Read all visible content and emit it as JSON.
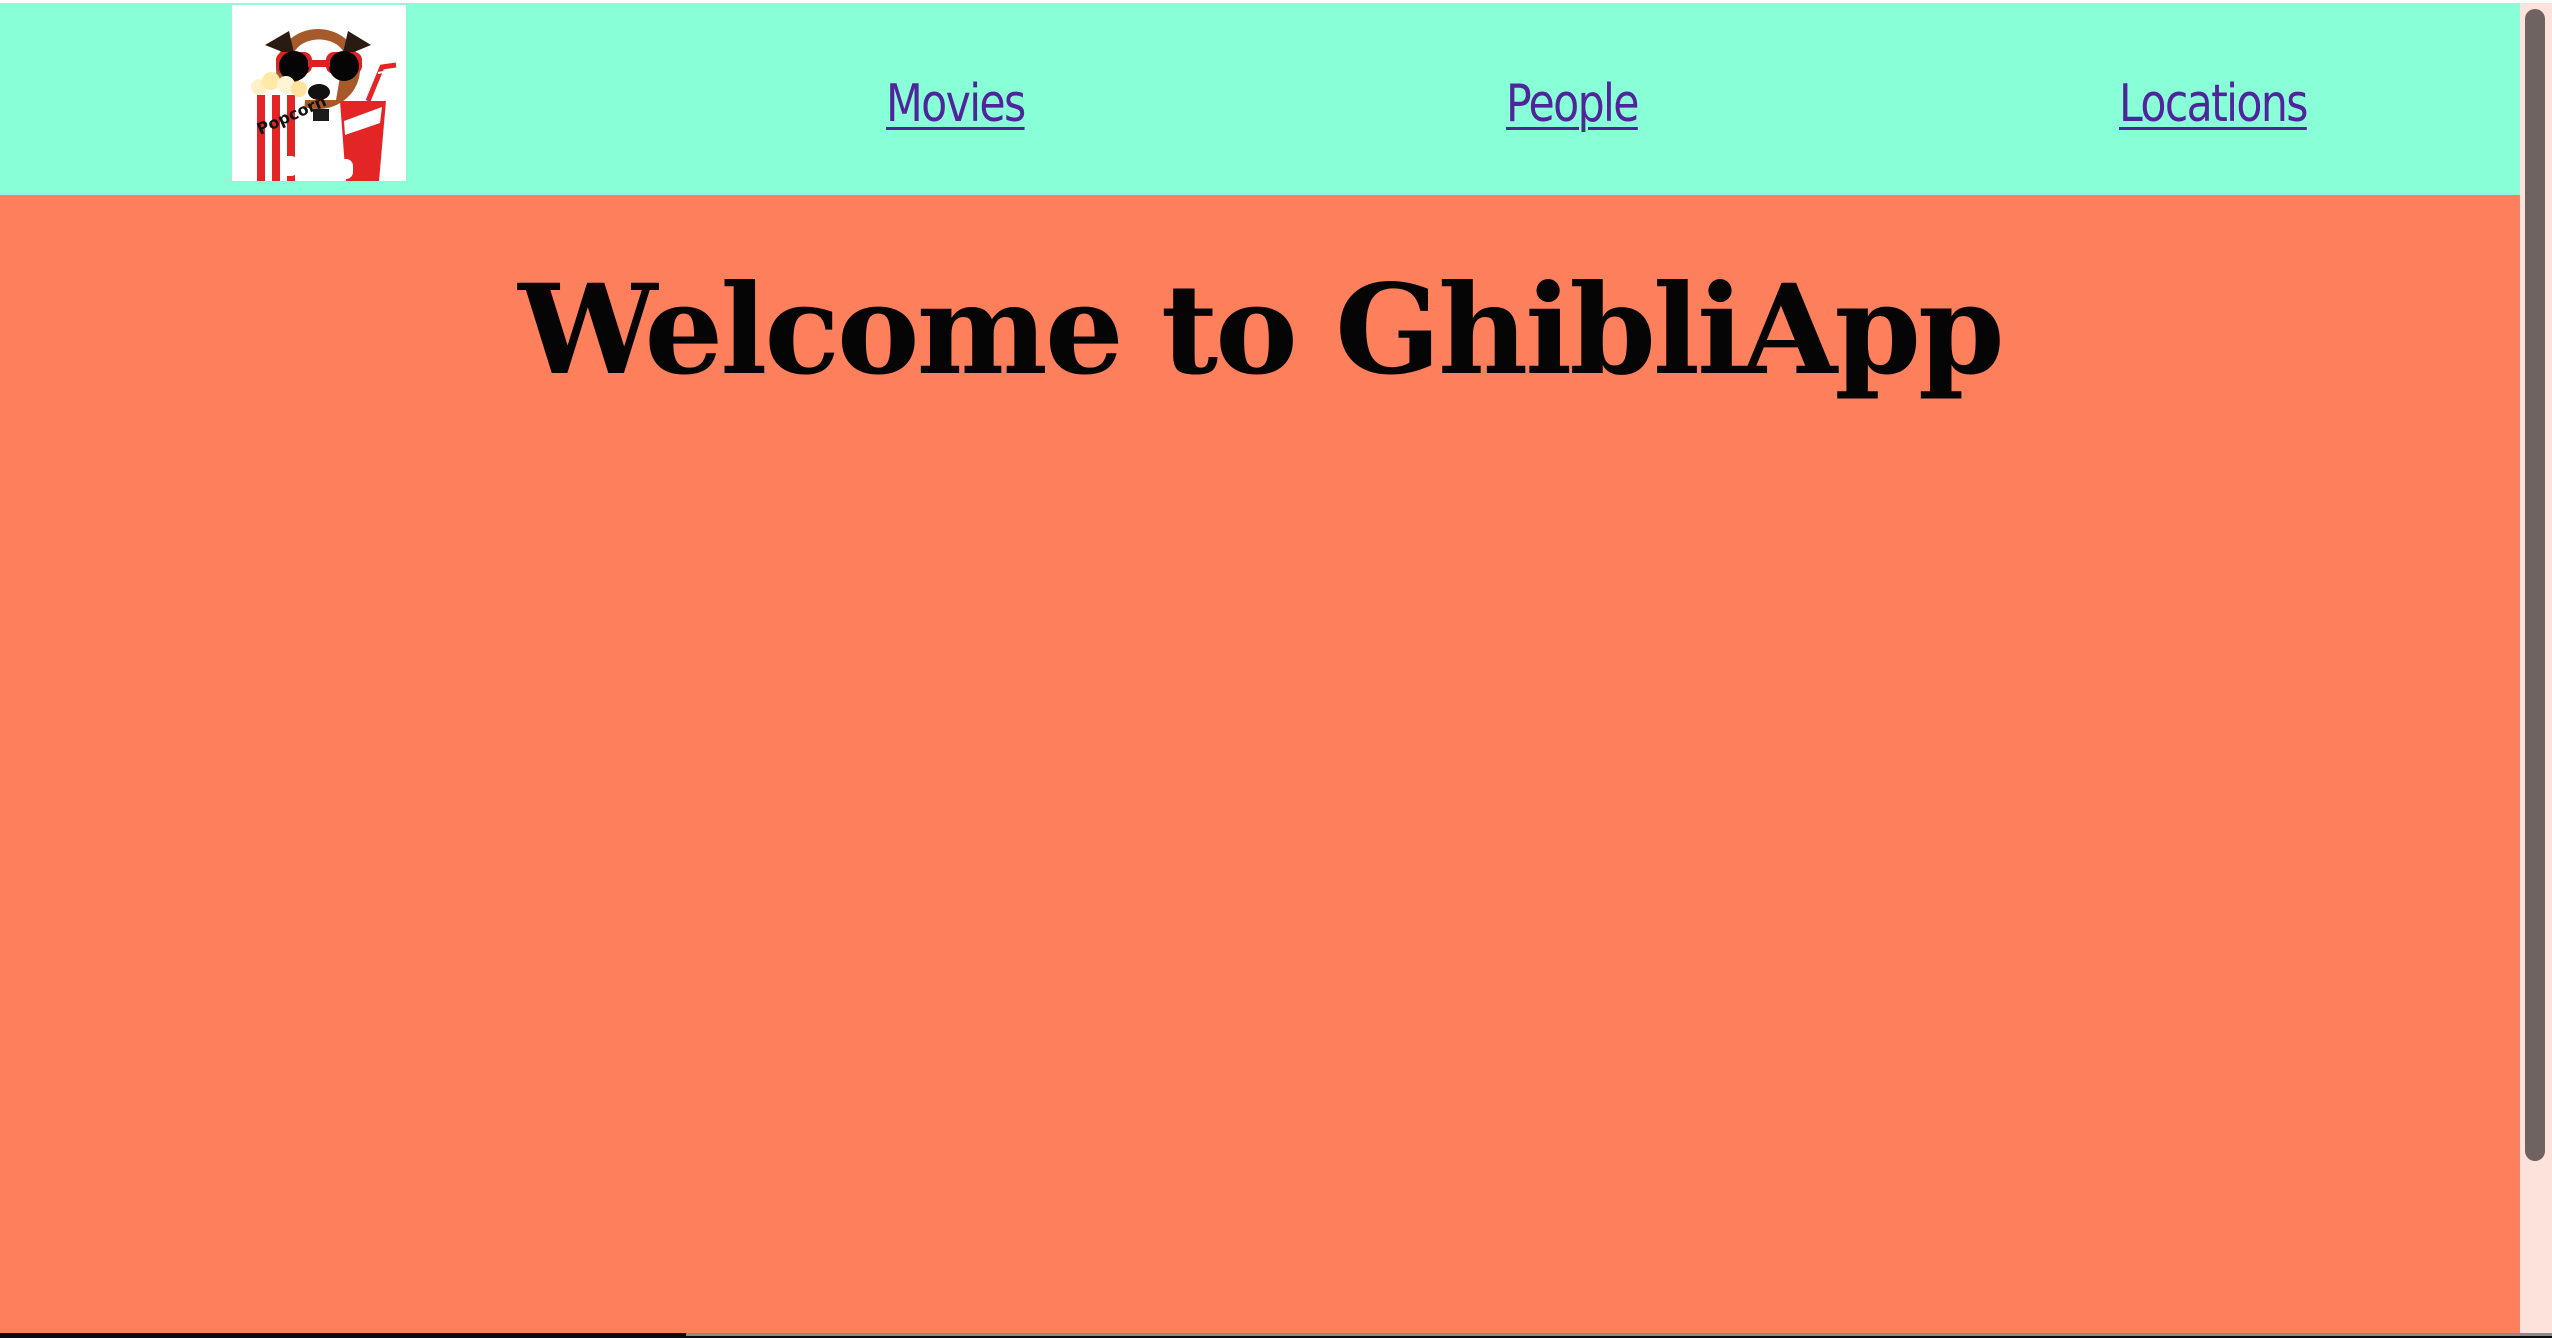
{
  "header": {
    "logo_icon": "popcorn-dog-icon",
    "logo_text": "Popcorn",
    "nav": [
      {
        "label": "Movies"
      },
      {
        "label": "People"
      },
      {
        "label": "Locations"
      }
    ]
  },
  "main": {
    "title": "Welcome to GhibliApp"
  },
  "colors": {
    "navbar_bg": "#88ffd6",
    "page_bg": "#fd7f5b",
    "link": "#50259c",
    "title": "#050505"
  }
}
